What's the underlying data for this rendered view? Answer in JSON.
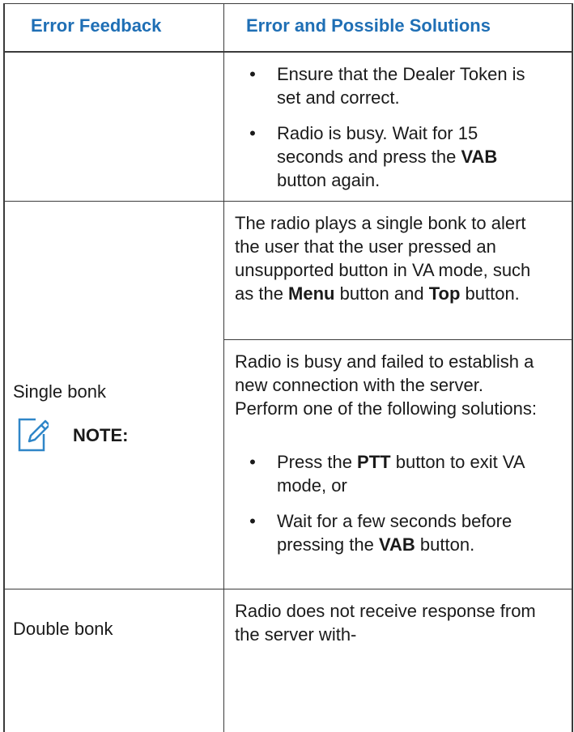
{
  "headers": {
    "col1": "Error Feedback",
    "col2": "Error and Possible Solutions"
  },
  "row1": {
    "bullet1": "Ensure that the Dealer Token is set and correct.",
    "bullet2": {
      "pre": "Radio is busy. Wait for 15 seconds and press the ",
      "bold": "VAB",
      "post": " button again."
    }
  },
  "single_bonk": {
    "label": "Single bonk",
    "note_label": "NOTE:",
    "note_icon": "note-pencil-icon",
    "para1": {
      "pre": "The radio plays a single bonk to alert the user that the user pressed an unsupported button in VA mode, such as the ",
      "bold1": "Menu",
      "mid": " button and ",
      "bold2": "Top",
      "post": " button."
    },
    "para2": "Radio is busy and failed to establish a new connection with the server. Perform one of the following solutions:",
    "bullet1": {
      "pre": "Press the ",
      "bold": "PTT",
      "post": " button to exit VA mode, or"
    },
    "bullet2": {
      "pre": "Wait for a few seconds before pressing the ",
      "bold": "VAB",
      "post": " button."
    }
  },
  "double_bonk": {
    "label": "Double bonk",
    "para": "Radio does not receive response from the server with-"
  },
  "colors": {
    "header_text": "#1f6fb5",
    "rule": "#3b3b3b",
    "icon_stroke": "#2f86c8"
  }
}
